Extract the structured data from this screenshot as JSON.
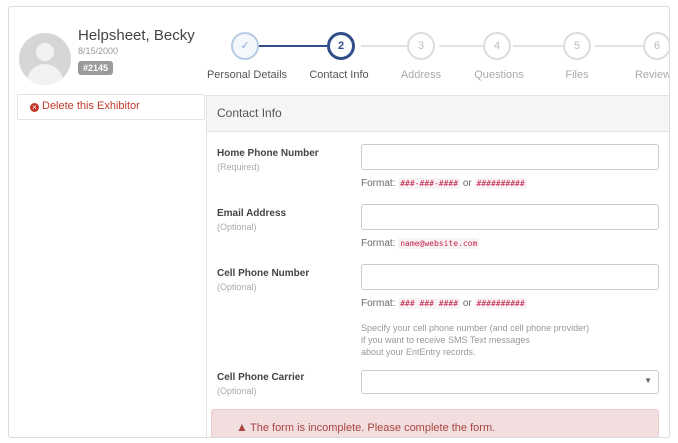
{
  "profile": {
    "name": "Helpsheet, Becky",
    "date": "8/15/2000",
    "badge": "#2145"
  },
  "sidebar": {
    "delete_label": "Delete this Exhibitor"
  },
  "steps": [
    {
      "number": "✓",
      "label": "Personal Details",
      "state": "complete"
    },
    {
      "number": "2",
      "label": "Contact Info",
      "state": "current"
    },
    {
      "number": "3",
      "label": "Address",
      "state": "pending"
    },
    {
      "number": "4",
      "label": "Questions",
      "state": "pending"
    },
    {
      "number": "5",
      "label": "Files",
      "state": "pending"
    },
    {
      "number": "6",
      "label": "Review",
      "state": "pending"
    }
  ],
  "panel": {
    "title": "Contact Info"
  },
  "fields": {
    "home_phone": {
      "label": "Home Phone Number",
      "sub": "(Required)",
      "value": "",
      "format_prefix": "Format:",
      "format_a": "###-###-####",
      "format_or": "or",
      "format_b": "##########"
    },
    "email": {
      "label": "Email Address",
      "sub": "(Optional)",
      "value": "",
      "format_prefix": "Format:",
      "format_a": "name@website.com"
    },
    "cell_phone": {
      "label": "Cell Phone Number",
      "sub": "(Optional)",
      "value": "",
      "format_prefix": "Format:",
      "format_a": "### ### ####",
      "format_or": "or",
      "format_b": "##########",
      "help_1": "Specify your cell phone number (and cell phone provider)",
      "help_2": "if you want to receive SMS Text messages",
      "help_3": "about your EntEntry records."
    },
    "carrier": {
      "label": "Cell Phone Carrier",
      "sub": "(Optional)",
      "value": ""
    }
  },
  "alert": {
    "message": "The form is incomplete. Please complete the form."
  },
  "colors": {
    "accent": "#2f4e8a",
    "danger": "#a94442",
    "danger_bg": "#f2dede"
  }
}
